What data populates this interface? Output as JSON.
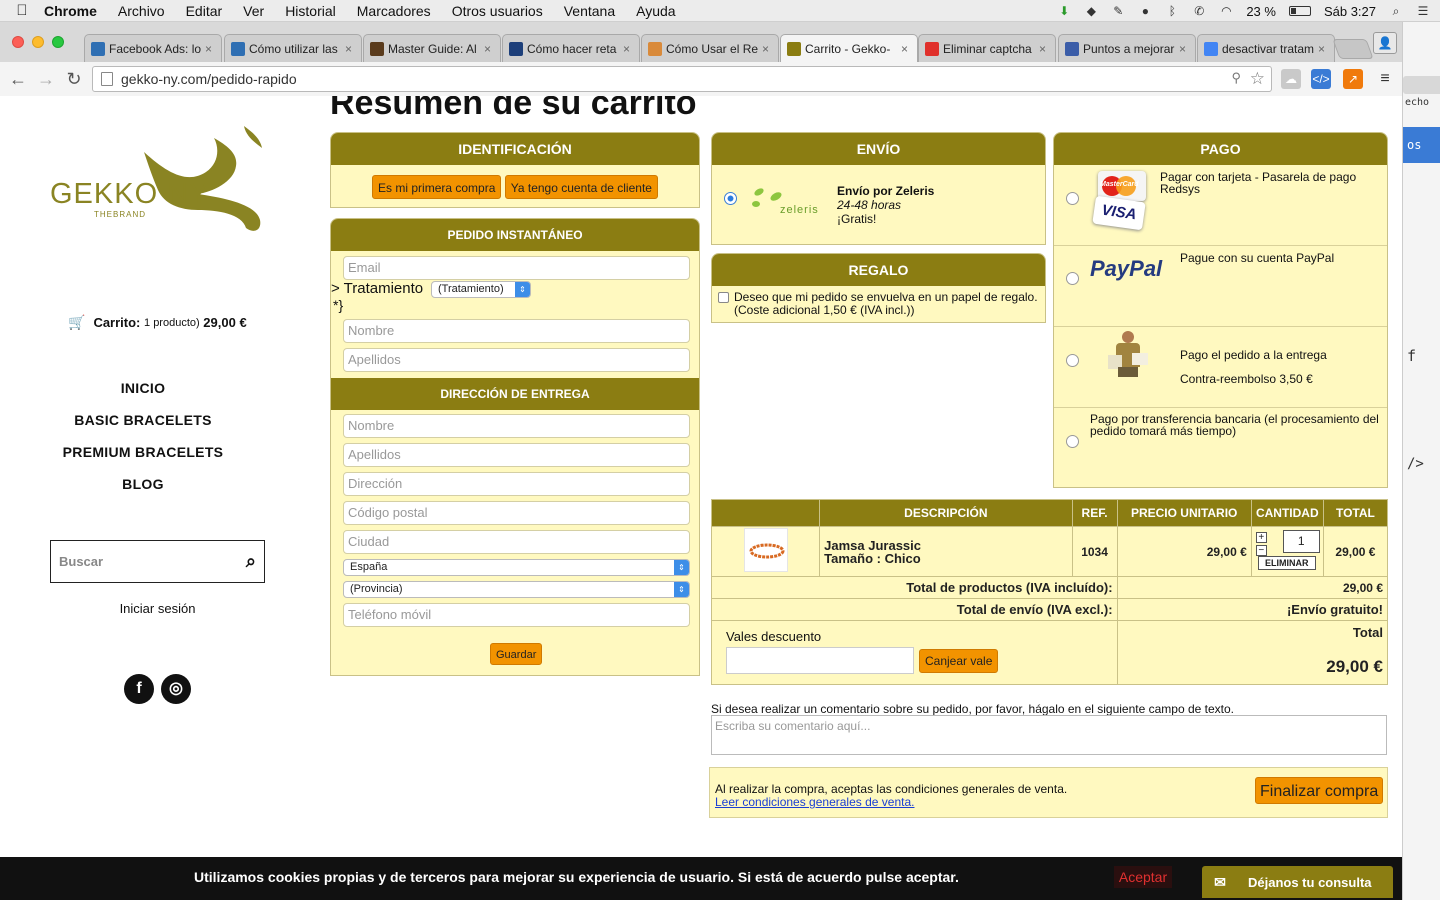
{
  "menubar": {
    "app": "Chrome",
    "items": [
      "Archivo",
      "Editar",
      "Ver",
      "Historial",
      "Marcadores",
      "Otros usuarios",
      "Ventana",
      "Ayuda"
    ],
    "battery": "23 %",
    "clock": "Sáb 3:27"
  },
  "tabs": [
    {
      "title": "Facebook Ads: lo",
      "color": "#2f6fb3"
    },
    {
      "title": "Cómo utilizar las",
      "color": "#2f6fb3"
    },
    {
      "title": "Master Guide: Al",
      "color": "#5a3b1c"
    },
    {
      "title": "Cómo hacer reta",
      "color": "#1d3f7a"
    },
    {
      "title": "Cómo Usar el Re",
      "color": "#d98a3a"
    },
    {
      "title": "Carrito - Gekko-",
      "color": "#8b7d12"
    },
    {
      "title": "Eliminar captcha",
      "color": "#e0302b"
    },
    {
      "title": "Puntos a mejorar",
      "color": "#3b5da8"
    },
    {
      "title": "desactivar tratam",
      "color": "#4285f4"
    }
  ],
  "address": {
    "url": "gekko-ny.com/pedido-rapido"
  },
  "sidebar": {
    "brand": "GEKKO NY",
    "brand_sub": "THEBRAND",
    "cart_label": "Carrito:",
    "cart_count": "1 producto)",
    "cart_total": "29,00 €",
    "nav": [
      "INICIO",
      "BASIC BRACELETS",
      "PREMIUM BRACELETS",
      "BLOG"
    ],
    "search_placeholder": "Buscar",
    "login": "Iniciar sesión",
    "social": [
      "f",
      "◎"
    ]
  },
  "page_title": "Resumen de su carrito",
  "ident": {
    "header": "IDENTIFICACIÓN",
    "first_purchase": "Es mi primera compra",
    "have_account": "Ya tengo cuenta de cliente"
  },
  "instant": {
    "header": "PEDIDO INSTANTÁNEO",
    "email": "Email",
    "treat_label": "> Tratamiento",
    "treat_value": "(Tratamiento)",
    "stray": "*}",
    "nombre": "Nombre",
    "apellidos": "Apellidos"
  },
  "delivery": {
    "header": "DIRECCIÓN DE ENTREGA",
    "nombre": "Nombre",
    "apellidos": "Apellidos",
    "direccion": "Dirección",
    "cp": "Código postal",
    "ciudad": "Ciudad",
    "pais": "España",
    "provincia": "(Provincia)",
    "telefono": "Teléfono móvil",
    "save": "Guardar"
  },
  "shipping": {
    "header": "ENVÍO",
    "logo_text": "zeleris",
    "name": "Envío por Zeleris",
    "time": "24-48 horas",
    "price": "¡Gratis!"
  },
  "gift": {
    "header": "REGALO",
    "text": "Deseo que mi pedido se envuelva en un papel de regalo. (Coste adicional 1,50 € (IVA incl.))"
  },
  "payment": {
    "header": "PAGO",
    "card": "Pagar con tarjeta - Pasarela de pago Redsys",
    "card_logo_mc": "MasterCard",
    "card_logo_visa": "VISA",
    "paypal_logo": "PayPal",
    "paypal": "Pague con su cuenta PayPal",
    "cod": "Pago el pedido a la entrega",
    "cod_fee": "Contra-reembolso 3,50 €",
    "transfer": "Pago por transferencia bancaria (el procesamiento del pedido tomará más tiempo)"
  },
  "cart_table": {
    "headers": [
      "DESCRIPCIÓN",
      "REF.",
      "PRECIO UNITARIO",
      "CANTIDAD",
      "TOTAL"
    ],
    "item": {
      "name": "Jamsa Jurassic",
      "size": "Tamaño : Chico",
      "ref": "1034",
      "price": "29,00 €",
      "qty": "1",
      "remove": "ELIMINAR",
      "total": "29,00 €"
    },
    "products_total_label": "Total de productos (IVA incluído):",
    "products_total": "29,00 €",
    "shipping_total_label": "Total de envío (IVA excl.):",
    "shipping_total": "¡Envío gratuito!",
    "voucher_label": "Vales descuento",
    "voucher_btn": "Canjear vale",
    "grand_label": "Total",
    "grand_total": "29,00 €"
  },
  "comment": {
    "label": "Si desea realizar un comentario sobre su pedido, por favor, hágalo en el siguiente campo de texto.",
    "placeholder": "Escriba su comentario aquí..."
  },
  "checkout": {
    "terms": "Al realizar la compra, aceptas las condiciones generales de venta.",
    "terms_link": "Leer condiciones generales de venta.",
    "finalize": "Finalizar compra"
  },
  "cookies": {
    "text": "Utilizamos cookies propias y de terceros para  mejorar su experiencia de usuario. Si está de acuerdo pulse aceptar.",
    "accept": "Aceptar",
    "consult": "Déjanos tu consulta"
  },
  "right_strip": {
    "t1": "echo",
    "t2": "os",
    "t3": "f",
    "t4": "/>"
  }
}
